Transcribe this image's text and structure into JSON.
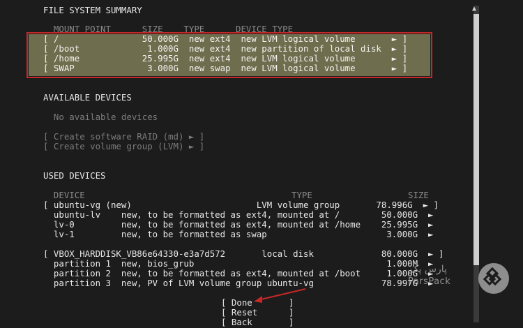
{
  "fs_summary": {
    "title": "FILE SYSTEM SUMMARY",
    "header": "  MOUNT POINT      SIZE    TYPE      DEVICE TYPE",
    "rows": [
      {
        "text": "[ /                50.000G  new ext4  new LVM logical volume       ► ]"
      },
      {
        "text": "[ /boot             1.000G  new ext4  new partition of local disk  ► ]"
      },
      {
        "text": "[ /home            25.995G  new ext4  new LVM logical volume       ► ]"
      },
      {
        "text": "[ SWAP              3.000G  new swap  new LVM logical volume       ► ]"
      }
    ]
  },
  "available": {
    "title": "AVAILABLE DEVICES",
    "none": "  No available devices",
    "actions": [
      "[ Create software RAID (md) ► ]",
      "[ Create volume group (LVM) ► ]"
    ]
  },
  "used": {
    "title": "USED DEVICES",
    "header_device": "  DEVICE",
    "header_type": "TYPE",
    "header_size": "SIZE",
    "rows": [
      {
        "text": "[ ubuntu-vg (new)                        LVM volume group       78.996G  ► ]"
      },
      {
        "text": "  ubuntu-lv    new, to be formatted as ext4, mounted at /        50.000G  ►"
      },
      {
        "text": "  lv-0         new, to be formatted as ext4, mounted at /home    25.995G  ►"
      },
      {
        "text": "  lv-1         new, to be formatted as swap                       3.000G  ►"
      },
      {
        "text": ""
      },
      {
        "text": "[ VBOX_HARDDISK_VB86e64330-e3a7d572       local disk             80.000G  ► ]"
      },
      {
        "text": "  partition 1  new, bios_grub                                     1.000M  ►"
      },
      {
        "text": "  partition 2  new, to be formatted as ext4, mounted at /boot     1.000G  ►"
      },
      {
        "text": "  partition 3  new, PV of LVM volume group ubuntu-vg             78.997G  ►"
      }
    ]
  },
  "buttons": {
    "done": "[ Done       ]",
    "reset": "[ Reset      ]",
    "back": "[ Back       ]"
  },
  "watermark": {
    "text_fa": "پارس پک",
    "text_en": "ParsPack"
  },
  "colors": {
    "background": "#1c1c1c",
    "highlight": "#6e6d4e",
    "annotation_red": "#c62828"
  }
}
